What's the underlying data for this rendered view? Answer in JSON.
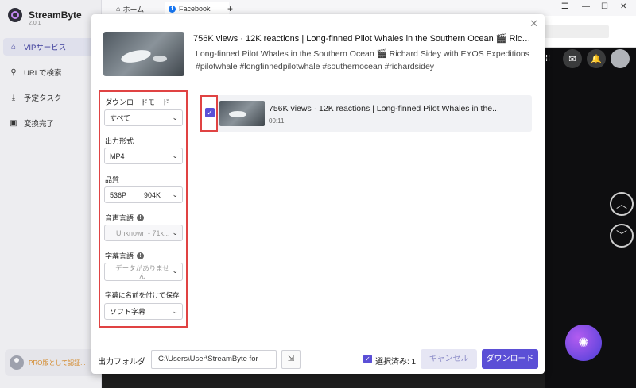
{
  "sidebar": {
    "brand": "StreamByte",
    "version": "2.0.1",
    "items": [
      {
        "label": "VIPサービス",
        "icon": "home-icon"
      },
      {
        "label": "URLで検索",
        "icon": "search-icon"
      },
      {
        "label": "予定タスク",
        "icon": "download-icon"
      },
      {
        "label": "変換完了",
        "icon": "inbox-icon"
      }
    ],
    "pro_text": "PRO版として認証..."
  },
  "browser": {
    "tabs": [
      {
        "label": "ホーム",
        "icon": "home-icon"
      },
      {
        "label": "Facebook",
        "icon": "facebook-icon"
      }
    ],
    "new_tab": "+"
  },
  "modal": {
    "title": "756K views · 12K reactions | Long-finned Pilot Whales in the Southern Ocean 🎬 Richard Sidey",
    "description": "Long-finned Pilot Whales in the Southern Ocean 🎬 Richard Sidey with EYOS Expeditions #pilotwhale #longfinnedpilotwhale #southernocean #richardsidey",
    "options": {
      "download_mode_label": "ダウンロードモード",
      "download_mode_value": "すべて",
      "format_label": "出力形式",
      "format_value": "MP4",
      "quality_label": "品質",
      "quality_resolution": "536P",
      "quality_size": "904K",
      "audio_lang_label": "音声言語",
      "audio_lang_value": "Unknown - 71k...",
      "subtitle_lang_label": "字幕言語",
      "subtitle_lang_value": "データがありません",
      "save_subtitle_label": "字幕に名前を付けて保存",
      "save_subtitle_value": "ソフト字幕"
    },
    "item": {
      "title": "756K views · 12K reactions | Long-finned Pilot Whales in the...",
      "duration": "00:11",
      "checked": true
    },
    "footer": {
      "folder_label": "出力フォルダ",
      "folder_path": "C:\\Users\\User\\StreamByte for",
      "selected_text": "選択済み: 1",
      "cancel_label": "キャンセル",
      "download_label": "ダウンロード"
    }
  },
  "colors": {
    "accent": "#5b4fd6",
    "highlight": "#e04343",
    "pro": "#d48a2c"
  }
}
